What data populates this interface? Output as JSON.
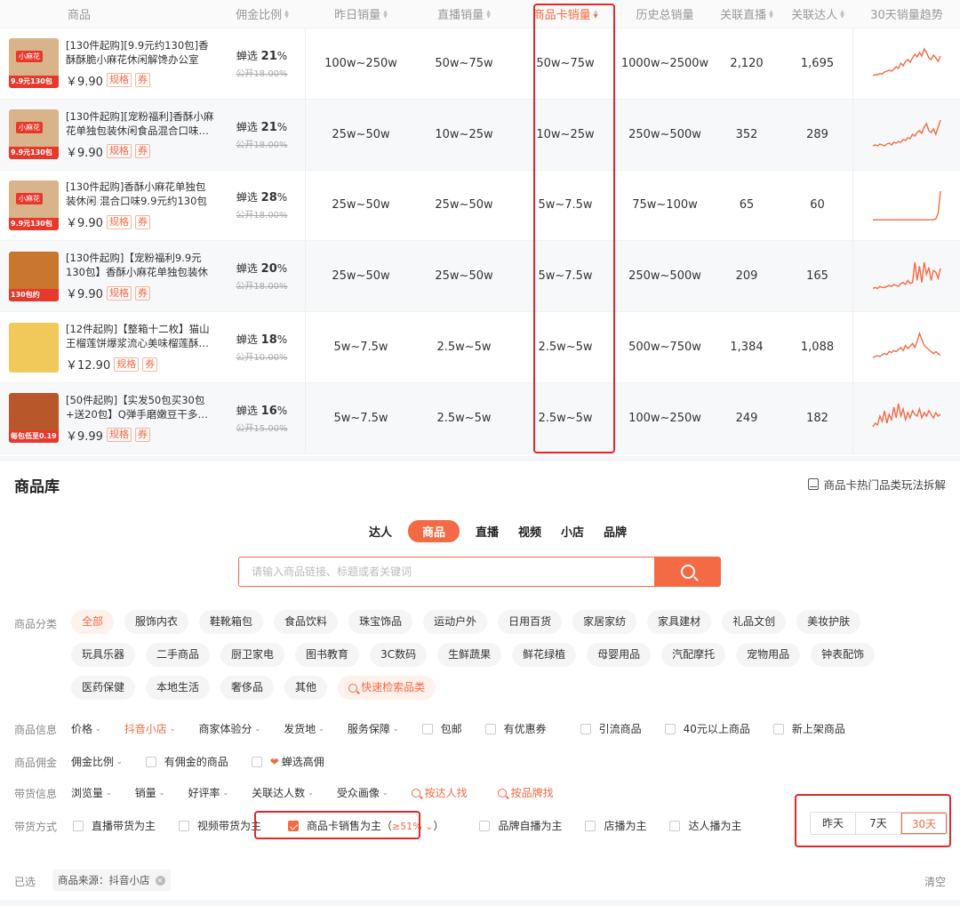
{
  "table": {
    "headers": {
      "product": "商品",
      "commission": "佣金比例",
      "yesterday": "昨日销量",
      "live": "直播销量",
      "card": "商品卡销量",
      "history": "历史总销量",
      "related_live": "关联直播",
      "related_talent": "关联达人",
      "trend": "30天销量趋势"
    },
    "rows": [
      {
        "title": "[130件起购][9.9元约130包]香酥酥脆小麻花休闲解馋办公室零…",
        "price": "￥9.90",
        "tag1": "规格",
        "tag2": "券",
        "commission_prefix": "蝉选",
        "commission": "21",
        "pct": "%",
        "public": "公开18.00%",
        "yesterday": "100w~250w",
        "live": "50w~75w",
        "card": "50w~75w",
        "history": "1000w~2500w",
        "related_live": "2,120",
        "related_talent": "1,695",
        "thumb_badge": "9.9元130包",
        "thumb_tag": "小麻花",
        "thumb_color": "#d9b48a",
        "trend": [
          4,
          5,
          5,
          6,
          6,
          8,
          9,
          10,
          9,
          11,
          14,
          12,
          18,
          15,
          20,
          22,
          19,
          24,
          28,
          25,
          30,
          26,
          34,
          30,
          24,
          22,
          27,
          24,
          20,
          26
        ]
      },
      {
        "title": "[130件起购][宠粉福利]香酥小麻花单独包装休闲食品混合口味…",
        "price": "￥9.90",
        "tag1": "规格",
        "tag2": "券",
        "commission_prefix": "蝉选",
        "commission": "21",
        "pct": "%",
        "public": "公开18.00%",
        "yesterday": "25w~50w",
        "live": "10w~25w",
        "card": "10w~25w",
        "history": "250w~500w",
        "related_live": "352",
        "related_talent": "289",
        "thumb_badge": "9.9元130包",
        "thumb_tag": "小麻花",
        "thumb_color": "#d9b48a",
        "trend": [
          5,
          6,
          5,
          7,
          6,
          5,
          7,
          8,
          6,
          9,
          8,
          10,
          9,
          12,
          11,
          14,
          13,
          18,
          16,
          20,
          22,
          19,
          26,
          30,
          22,
          20,
          24,
          18,
          26,
          34
        ]
      },
      {
        "title": "[130件起购]香酥小麻花单独包装休闲 混合口味9.9元约130包",
        "price": "￥9.90",
        "tag1": "规格",
        "tag2": "券",
        "commission_prefix": "蝉选",
        "commission": "28",
        "pct": "%",
        "public": "公开18.00%",
        "yesterday": "25w~50w",
        "live": "25w~50w",
        "card": "5w~7.5w",
        "history": "75w~100w",
        "related_live": "65",
        "related_talent": "60",
        "thumb_badge": "9.9元130包",
        "thumb_tag": "小麻花",
        "thumb_color": "#d9b48a",
        "trend": [
          2,
          2,
          2,
          2,
          2,
          2,
          2,
          2,
          2,
          2,
          2,
          2,
          2,
          2,
          2,
          2,
          2,
          2,
          2,
          2,
          2,
          2,
          2,
          2,
          2,
          2,
          2,
          3,
          10,
          38
        ]
      },
      {
        "title": "[130件起购]【宠粉福利9.9元130包】香酥小麻花单独包装休闲…",
        "price": "￥9.90",
        "tag1": "规格",
        "tag2": "券",
        "commission_prefix": "蝉选",
        "commission": "20",
        "pct": "%",
        "public": "公开18.00%",
        "yesterday": "25w~50w",
        "live": "25w~50w",
        "card": "5w~7.5w",
        "history": "250w~500w",
        "related_live": "209",
        "related_talent": "165",
        "thumb_badge": "130包约",
        "thumb_tag": "",
        "thumb_color": "#c9762f",
        "trend": [
          4,
          5,
          4,
          6,
          5,
          5,
          6,
          7,
          6,
          8,
          7,
          6,
          9,
          10,
          8,
          12,
          9,
          10,
          30,
          12,
          26,
          10,
          30,
          18,
          25,
          12,
          22,
          20,
          14,
          24
        ]
      },
      {
        "title": "[12件起购]【整箱十二枚】猫山王榴莲饼爆浆流心美味榴莲酥…",
        "price": "￥12.90",
        "tag1": "规格",
        "tag2": "券",
        "commission_prefix": "蝉选",
        "commission": "18",
        "pct": "%",
        "public": "公开10.00%",
        "yesterday": "5w~7.5w",
        "live": "2.5w~5w",
        "card": "2.5w~5w",
        "history": "500w~750w",
        "related_live": "1,384",
        "related_talent": "1,088",
        "thumb_badge": "",
        "thumb_tag": "",
        "thumb_color": "#f0c95a",
        "trend": [
          6,
          7,
          8,
          7,
          9,
          10,
          9,
          12,
          11,
          13,
          12,
          14,
          16,
          13,
          18,
          15,
          17,
          20,
          16,
          22,
          30,
          24,
          18,
          16,
          14,
          12,
          10,
          12,
          10,
          8
        ]
      },
      {
        "title": "[50件起购]【实发50包买30包+送20包】Q弹手磨嫩豆干多…",
        "price": "￥9.99",
        "tag1": "规格",
        "tag2": "券",
        "commission_prefix": "蝉选",
        "commission": "16",
        "pct": "%",
        "public": "公开15.00%",
        "yesterday": "5w~7.5w",
        "live": "2.5w~5w",
        "card": "2.5w~5w",
        "history": "100w~250w",
        "related_live": "249",
        "related_talent": "182",
        "thumb_badge": "每包低至0.19元",
        "thumb_tag": "",
        "thumb_color": "#b8582a",
        "trend": [
          8,
          12,
          10,
          20,
          14,
          26,
          12,
          22,
          16,
          30,
          18,
          34,
          20,
          28,
          16,
          24,
          18,
          26,
          22,
          20,
          28,
          18,
          24,
          20,
          26,
          22,
          18,
          24,
          20,
          22
        ]
      }
    ]
  },
  "library": {
    "title": "商品库",
    "link": "商品卡热门品类玩法拆解",
    "tabs": [
      "达人",
      "商品",
      "直播",
      "视频",
      "小店",
      "品牌"
    ],
    "active_tab": "商品",
    "search_placeholder": "请输入商品链接、标题或者关键词",
    "category_label": "商品分类",
    "categories": [
      "全部",
      "服饰内衣",
      "鞋靴箱包",
      "食品饮料",
      "珠宝饰品",
      "运动户外",
      "日用百货",
      "家居家纺",
      "家具建材",
      "礼品文创",
      "美妆护肤",
      "玩具乐器",
      "二手商品",
      "厨卫家电",
      "图书教育",
      "3C数码",
      "生鲜蔬果",
      "鲜花绿植",
      "母婴用品",
      "汽配摩托",
      "宠物用品",
      "钟表配饰",
      "医药保健",
      "本地生活",
      "奢侈品",
      "其他"
    ],
    "category_search": "快速检索品类",
    "info_label": "商品信息",
    "info_dropdowns": [
      "价格",
      "抖音小店",
      "商家体验分",
      "发货地",
      "服务保障"
    ],
    "info_checks": [
      "包邮",
      "有优惠券",
      "引流商品",
      "40元以上商品",
      "新上架商品"
    ],
    "commission_label": "商品佣金",
    "commission_dropdown": "佣金比例",
    "commission_checks": [
      "有佣金的商品",
      "蝉选高佣"
    ],
    "goods_label": "带货信息",
    "goods_dropdowns": [
      "浏览量",
      "销量",
      "好评率",
      "关联达人数",
      "受众画像"
    ],
    "goods_links": [
      "按达人找",
      "按品牌找"
    ],
    "mode_label": "带货方式",
    "mode_checks": [
      "直播带货为主",
      "视频带货为主"
    ],
    "mode_checked": "商品卡销售为主（",
    "mode_checked_pct": "≥51%",
    "mode_checked_close": "）",
    "mode_checks_after": [
      "品牌自播为主",
      "店播为主",
      "达人播为主"
    ],
    "time_options": [
      "昨天",
      "7天",
      "30天"
    ],
    "selected_label": "已选",
    "selected_chip": "商品来源：抖音小店",
    "clear": "清空"
  },
  "colors": {
    "accent": "#f46a45",
    "highlight": "#e2262b"
  }
}
